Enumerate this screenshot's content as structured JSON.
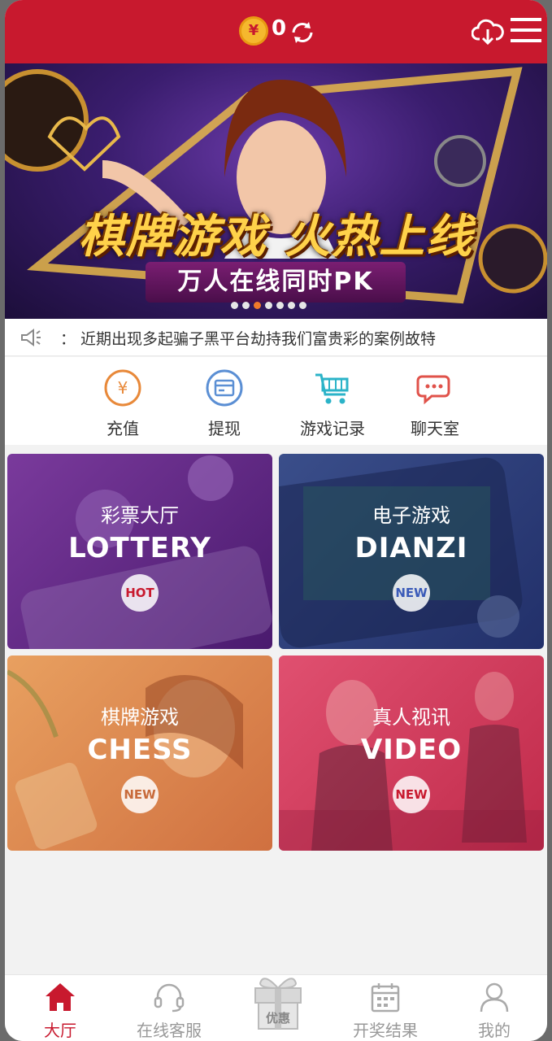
{
  "header": {
    "coin_symbol": "¥",
    "balance": "0",
    "icons": [
      "coin-icon",
      "refresh-icon",
      "cloud-download-icon",
      "menu-icon"
    ],
    "bg_color": "#c8192e"
  },
  "banner": {
    "title": "棋牌游戏 火热上线",
    "subtitle": "万人在线同时PK",
    "slide_count": 7,
    "active_slide": 2
  },
  "notice": {
    "icon": "speaker-icon",
    "text": "： 近期出现多起骗子黑平台劫持我们富贵彩的案例故特"
  },
  "quick_actions": [
    {
      "label": "充值",
      "icon": "recharge-icon"
    },
    {
      "label": "提现",
      "icon": "withdraw-icon"
    },
    {
      "label": "游戏记录",
      "icon": "cart-icon"
    },
    {
      "label": "聊天室",
      "icon": "chat-icon"
    }
  ],
  "games": [
    {
      "cn": "彩票大厅",
      "en": "LOTTERY",
      "badge": "HOT",
      "color": "#6a2a8c",
      "badge_color": "#c8192e"
    },
    {
      "cn": "电子游戏",
      "en": "DIANZI",
      "badge": "NEW",
      "color": "#2c3e7a",
      "badge_color": "#3a5bb8"
    },
    {
      "cn": "棋牌游戏",
      "en": "CHESS",
      "badge": "NEW",
      "color": "#e0884a",
      "badge_color": "#c86a3a"
    },
    {
      "cn": "真人视讯",
      "en": "VIDEO",
      "badge": "NEW",
      "color": "#d23a5e",
      "badge_color": "#c8192e"
    }
  ],
  "bottom_nav": [
    {
      "label": "大厅",
      "icon": "home-icon",
      "active": true
    },
    {
      "label": "在线客服",
      "icon": "headset-icon",
      "active": false
    },
    {
      "label": "优惠",
      "icon": "gift-icon",
      "active": false
    },
    {
      "label": "开奖结果",
      "icon": "calendar-icon",
      "active": false
    },
    {
      "label": "我的",
      "icon": "user-icon",
      "active": false
    }
  ]
}
